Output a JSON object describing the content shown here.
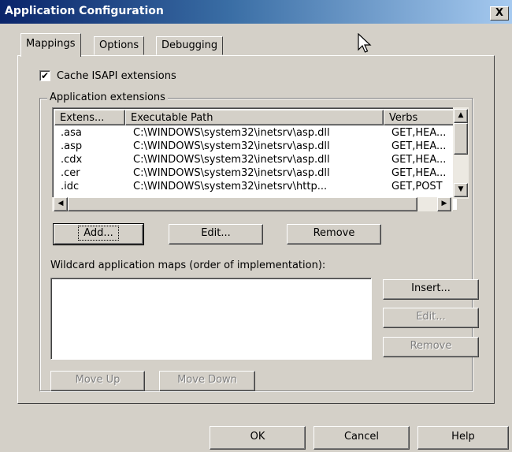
{
  "window": {
    "title": "Application Configuration",
    "close_label": "X"
  },
  "tabs": [
    {
      "label": "Mappings",
      "active": true
    },
    {
      "label": "Options",
      "active": false
    },
    {
      "label": "Debugging",
      "active": false
    }
  ],
  "cache": {
    "label": "Cache ISAPI extensions",
    "checked": true,
    "check_mark": "✔"
  },
  "extensions": {
    "legend": "Application extensions",
    "columns": [
      "Extens...",
      "Executable Path",
      "Verbs"
    ],
    "rows": [
      [
        ".asa",
        "C:\\WINDOWS\\system32\\inetsrv\\asp.dll",
        "GET,HEA..."
      ],
      [
        ".asp",
        "C:\\WINDOWS\\system32\\inetsrv\\asp.dll",
        "GET,HEA..."
      ],
      [
        ".cdx",
        "C:\\WINDOWS\\system32\\inetsrv\\asp.dll",
        "GET,HEA..."
      ],
      [
        ".cer",
        "C:\\WINDOWS\\system32\\inetsrv\\asp.dll",
        "GET,HEA..."
      ],
      [
        ".idc",
        "C:\\WINDOWS\\system32\\inetsrv\\http...",
        "GET,POST"
      ]
    ],
    "add_label": "Add...",
    "edit_label": "Edit...",
    "remove_label": "Remove"
  },
  "wildcard": {
    "label": "Wildcard application maps (order of implementation):",
    "insert_label": "Insert...",
    "edit_label": "Edit...",
    "remove_label": "Remove",
    "move_up_label": "Move Up",
    "move_down_label": "Move Down"
  },
  "footer": {
    "ok_label": "OK",
    "cancel_label": "Cancel",
    "help_label": "Help"
  },
  "colors": {
    "face": "#d4d0c8",
    "title_start": "#0a246a",
    "title_end": "#a6caf0",
    "disabled_text": "#808080"
  }
}
